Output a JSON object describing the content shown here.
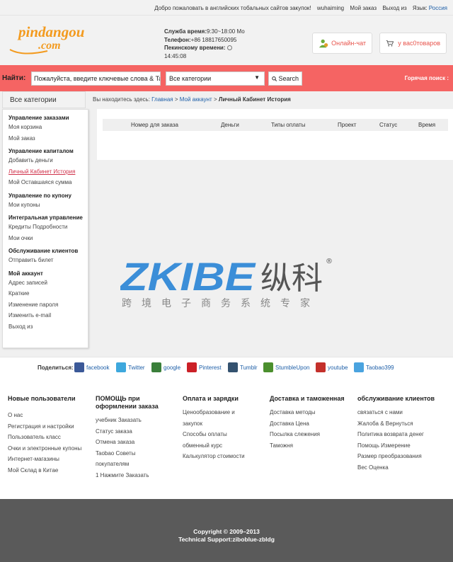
{
  "topbar": {
    "welcome": "Добро пожаловать в английских тобальных сайтов закупок!",
    "username": "wuhaiming",
    "my_orders": "Мой заказ",
    "logout": "Выход из",
    "language_label": "Язык:",
    "language": "Россия"
  },
  "header": {
    "logo_top": "pindangou",
    "logo_bottom": ".com",
    "service_label": "Служба время:",
    "service_value": "9:30~18:00 Мо",
    "phone_label": "Телефон:",
    "phone_value": "+86 18817650095",
    "beijing_label": "Пекинскому времени:",
    "beijing_time": "14:45:08",
    "chat_label": "Онлайн-чат",
    "cart_label": "у вас0товаров"
  },
  "search": {
    "label": "Найти:",
    "input_value": "Пожалуйста, введите ключевые слова & Taob",
    "category_value": "Все категории",
    "button": "Search",
    "hot_label": "Горячая поиск :"
  },
  "sidebar": {
    "all_categories": "Все категории",
    "groups": [
      {
        "title": "Управление заказами",
        "items": [
          "Моя корзина",
          "Мой заказ"
        ]
      },
      {
        "title": "Управление капиталом",
        "items": [
          "Добавить деньги",
          "Личный Кабинет История",
          "Мой Оставшаяся сумма"
        ]
      },
      {
        "title": "Управление по купону",
        "items": [
          "Мои купоны"
        ]
      },
      {
        "title": "Интегральная управление",
        "items": [
          "Кредиты Подробности",
          "Мои очки"
        ]
      },
      {
        "title": "Обслуживание клиентов",
        "items": [
          "Отправить билет"
        ]
      },
      {
        "title": "Мой аккаунт",
        "items": [
          "Адрес записей",
          "Краткие",
          "Изменение пароля",
          "Изменить e-mail",
          "Выход из"
        ]
      }
    ]
  },
  "breadcrumb": {
    "prefix": "Вы находитесь здесь:",
    "home": "Главная",
    "sep": ">",
    "account": "Мой аккаунт",
    "current": "Личный Кабинет История"
  },
  "table": {
    "headers": [
      "Номер для заказа",
      "Деньги",
      "Типы оплаты",
      "Проект",
      "Статус",
      "Время"
    ]
  },
  "watermark": {
    "brand": "ZKIBE",
    "cn_name": "纵科",
    "tagline": "跨境电子商务系统专家",
    "registered": "®"
  },
  "share": {
    "label": "Поделиться:",
    "items": [
      {
        "name": "facebook",
        "color": "#3b5998"
      },
      {
        "name": "Twitter",
        "color": "#3ea8dd"
      },
      {
        "name": "google",
        "color": "#3a7f3a"
      },
      {
        "name": "Pinterest",
        "color": "#cb2027"
      },
      {
        "name": "Tumblr",
        "color": "#34526f"
      },
      {
        "name": "StumbleUpon",
        "color": "#4b8f2e"
      },
      {
        "name": "youtube",
        "color": "#c4302b"
      },
      {
        "name": "Taobao399",
        "color": "#4aa3df"
      }
    ]
  },
  "footer": {
    "columns": [
      {
        "title": "Новые пользователи",
        "items": [
          "О нас",
          "Регистрация и настройки",
          "Пользователь класс",
          "Очки и электронные купоны",
          "Интернет-магазины",
          "Мой Склад в Китае"
        ]
      },
      {
        "title": "ПОМОЩЬ при оформлении заказа",
        "items": [
          "учебник Заказать",
          "Статус заказа",
          "Отмена заказа",
          "Taobao Советы",
          "покупателям",
          "1 Нажмите Заказать"
        ]
      },
      {
        "title": "Оплата и зарядки",
        "items": [
          "Ценообразование и",
          "закупок",
          "Способы оплаты",
          "обменный курс",
          "Калькулятор стоимости"
        ]
      },
      {
        "title": "Доставка и таможенная",
        "items": [
          "Доставка методы",
          "Доставка Цена",
          "Посылка слежения",
          "Таможня"
        ]
      },
      {
        "title": "обслуживание клиентов",
        "items": [
          "связаться с нами",
          "Жалоба & Вернуться",
          "Политика возврата денег",
          "Помощь Измерение",
          "Размер преобразования",
          "Вес Оценка"
        ]
      }
    ]
  },
  "copyright": {
    "line1": "Copyright © 2009–2013",
    "line2": "Technical Support:ziboblue-zbldg"
  },
  "colors": {
    "accent": "#f56463",
    "link": "#1e5fa8",
    "logo_orange": "#f39a1e",
    "active_red": "#d0324b",
    "footer_bg": "#5a5a5a",
    "watermark_blue": "#3b8ed8"
  }
}
